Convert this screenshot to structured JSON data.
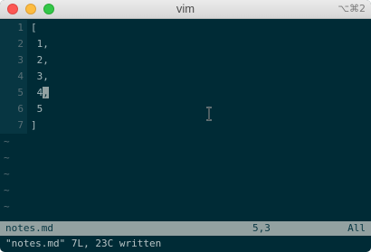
{
  "window": {
    "title": "vim",
    "shortcut": "⌥⌘2"
  },
  "editor": {
    "lines": [
      {
        "number": "1",
        "text": "["
      },
      {
        "number": "2",
        "text": " 1,"
      },
      {
        "number": "3",
        "text": " 2,"
      },
      {
        "number": "4",
        "text": " 3,"
      },
      {
        "number": "5",
        "text_before": " 4",
        "cursor_char": ",",
        "text_after": ""
      },
      {
        "number": "6",
        "text": " 5"
      },
      {
        "number": "7",
        "text": "]"
      }
    ],
    "tilde": "~"
  },
  "statusline": {
    "filename": "notes.md",
    "position": "5,3",
    "scroll": "All"
  },
  "cmdline": {
    "message": "\"notes.md\" 7L, 23C written"
  },
  "colors": {
    "background": "#002b36",
    "gutter": "#073642",
    "statusline": "#93a1a1"
  }
}
